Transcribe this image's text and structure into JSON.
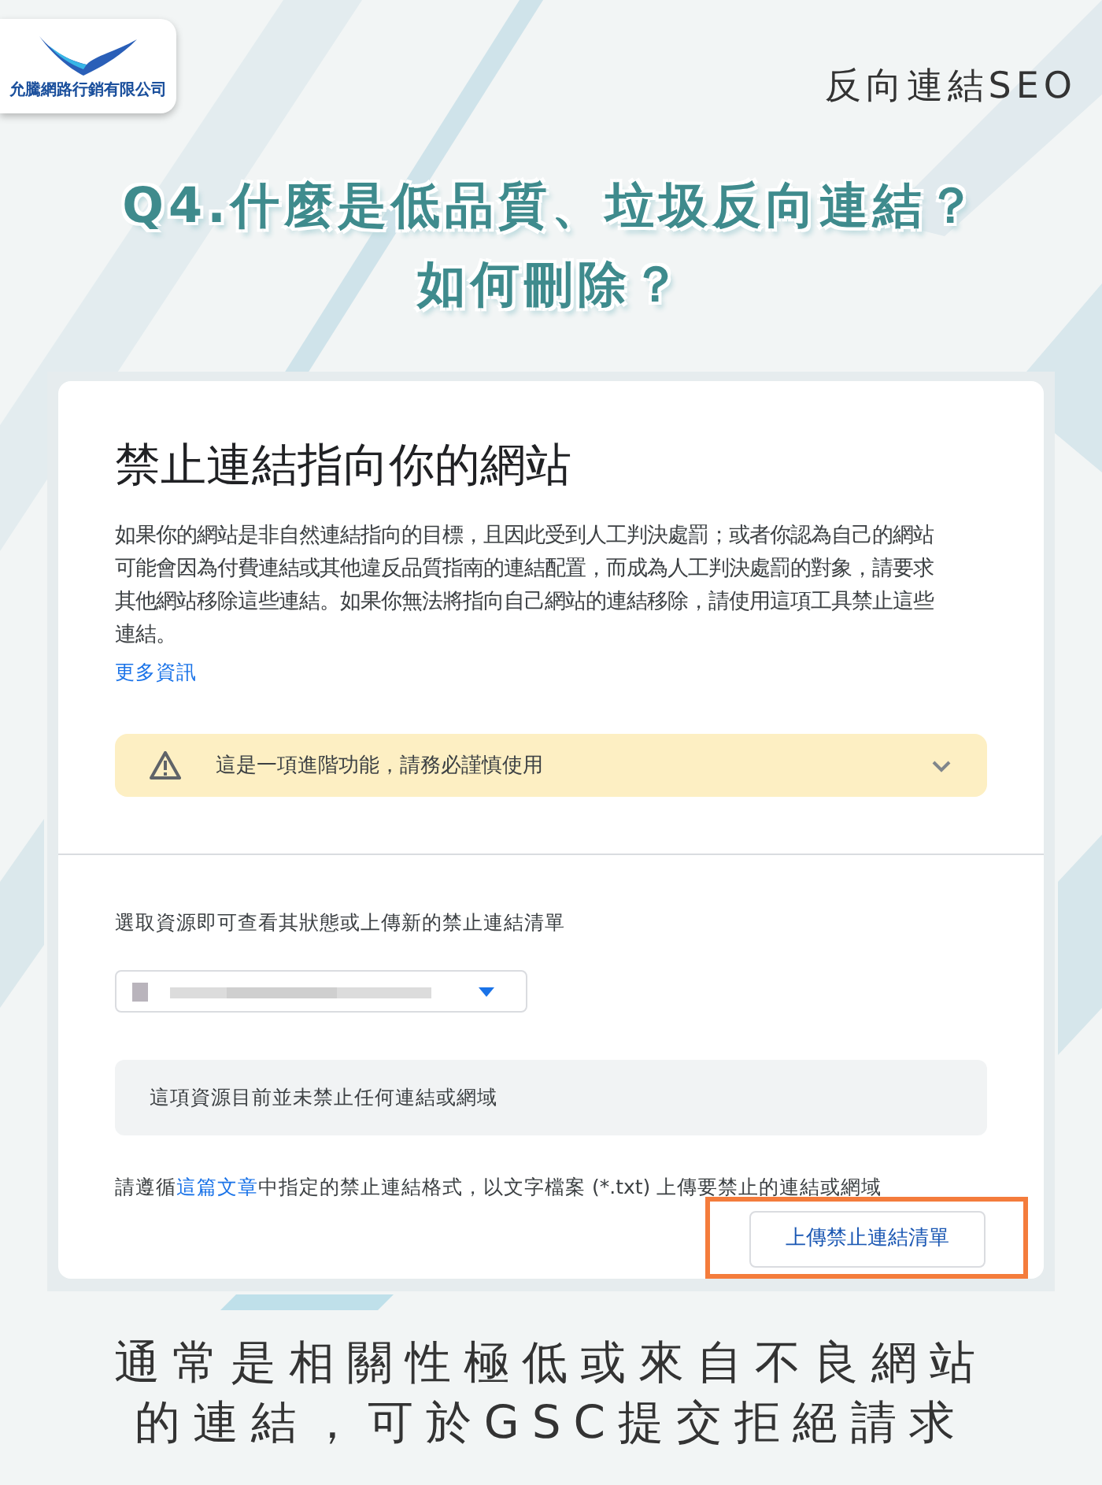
{
  "logo": {
    "company": "允騰網路行銷有限公司"
  },
  "tag": "反向連結SEO",
  "headline": [
    "Q4.什麼是低品質、垃圾反向連結？",
    "如何刪除？"
  ],
  "panel": {
    "title": "禁止連結指向你的網站",
    "description": "如果你的網站是非自然連結指向的目標，且因此受到人工判決處罰；或者你認為自己的網站可能會因為付費連結或其他違反品質指南的連結配置，而成為人工判決處罰的對象，請要求其他網站移除這些連結。如果你無法將指向自己網站的連結移除，請使用這項工具禁止這些連結。",
    "more_link": "更多資訊",
    "warning": {
      "text": "這是一項進階功能，請務必謹慎使用",
      "expanded": false
    },
    "property_label": "選取資源即可查看其狀態或上傳新的禁止連結清單",
    "status_message": "這項資源目前並未禁止任何連結或網域",
    "instructions": {
      "before": "請遵循",
      "link": "這篇文章",
      "after": "中指定的禁止連結格式，以文字檔案 (*.txt) 上傳要禁止的連結或網域"
    },
    "upload_button": {
      "label": "上傳禁止連結清單",
      "highlighted": true
    }
  },
  "caption": "通常是相關性極低或來自不良網站的連結，可於GSC提交拒絕請求"
}
